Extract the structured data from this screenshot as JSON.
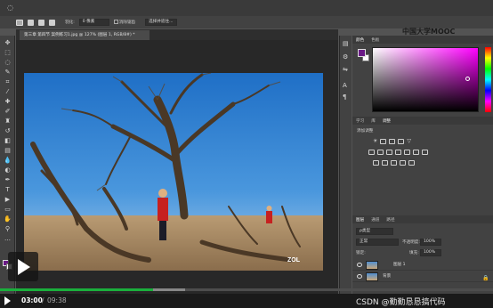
{
  "options_bar": {
    "feather_label": "羽化:",
    "feather_value": "0 像素",
    "antialias_label": "消除锯齿",
    "select_mask_label": "选择并遮住..."
  },
  "document": {
    "tab_title": "第三章 第四节 案例练习1.jpg @ 127% (图层 1, RGB/8#) *",
    "photo_watermark": "ZOL"
  },
  "watermark": {
    "text": "中国大学MOOC"
  },
  "panels": {
    "color_tabs": [
      "颜色",
      "色板"
    ],
    "mid_tabs": [
      "学习",
      "库",
      "调整"
    ],
    "adjust_title": "添加调整",
    "layer_tabs": [
      "图层",
      "通道",
      "路径"
    ],
    "kind_filter": "ρ类型",
    "blend_mode": "正常",
    "opacity_label": "不透明度:",
    "opacity_value": "100%",
    "lock_label": "锁定:",
    "fill_label": "填充:",
    "fill_value": "100%",
    "layers": [
      {
        "name": "图层 1"
      },
      {
        "name": "背景"
      }
    ]
  },
  "player": {
    "current_time": "03:00",
    "separator": "/",
    "total_time": "09:38",
    "progress": 0.31,
    "csdn_text": "CSDN @勤勤恳恳搞代码"
  },
  "colors": {
    "foreground": "#6a1a86",
    "background": "#ffffff",
    "progress": "#1aaf3c"
  }
}
